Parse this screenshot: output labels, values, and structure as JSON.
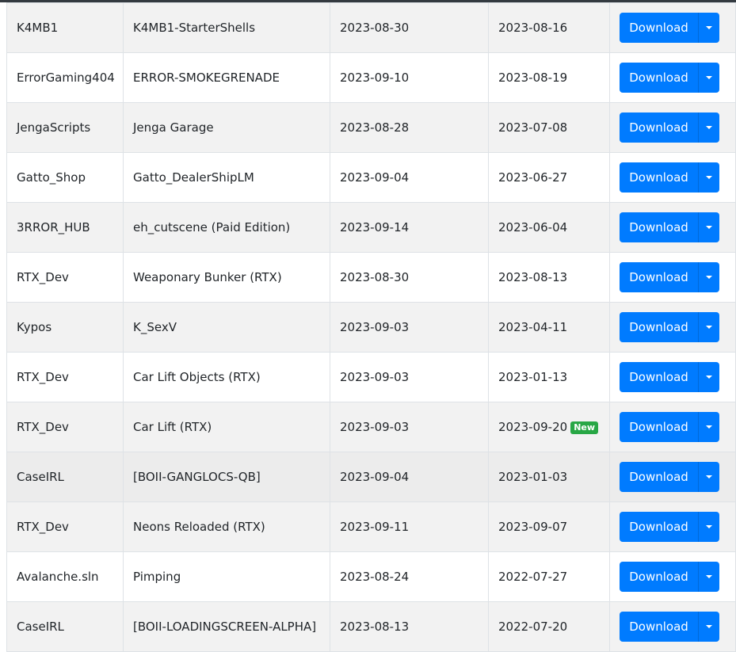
{
  "table": {
    "rows": [
      {
        "author": "K4MB1",
        "name": "K4MB1-StarterShells",
        "updated": "2023-08-30",
        "created": "2023-08-16",
        "badge": "",
        "action": "Download"
      },
      {
        "author": "ErrorGaming404",
        "name": "ERROR-SMOKEGRENADE",
        "updated": "2023-09-10",
        "created": "2023-08-19",
        "badge": "",
        "action": "Download"
      },
      {
        "author": "JengaScripts",
        "name": "Jenga Garage",
        "updated": "2023-08-28",
        "created": "2023-07-08",
        "badge": "",
        "action": "Download"
      },
      {
        "author": "Gatto_Shop",
        "name": "Gatto_DealerShipLM",
        "updated": "2023-09-04",
        "created": "2023-06-27",
        "badge": "",
        "action": "Download"
      },
      {
        "author": "3RROR_HUB",
        "name": "eh_cutscene (Paid Edition)",
        "updated": "2023-09-14",
        "created": "2023-06-04",
        "badge": "",
        "action": "Download"
      },
      {
        "author": "RTX_Dev",
        "name": "Weaponary Bunker (RTX)",
        "updated": "2023-08-30",
        "created": "2023-08-13",
        "badge": "",
        "action": "Download"
      },
      {
        "author": "Kypos",
        "name": "K_SexV",
        "updated": "2023-09-03",
        "created": "2023-04-11",
        "badge": "",
        "action": "Download"
      },
      {
        "author": "RTX_Dev",
        "name": "Car Lift Objects (RTX)",
        "updated": "2023-09-03",
        "created": "2023-01-13",
        "badge": "",
        "action": "Download"
      },
      {
        "author": "RTX_Dev",
        "name": "Car Lift (RTX)",
        "updated": "2023-09-03",
        "created": "2023-09-20",
        "badge": "New",
        "action": "Download"
      },
      {
        "author": "CaseIRL",
        "name": "[BOII-GANGLOCS-QB]",
        "updated": "2023-09-04",
        "created": "2023-01-03",
        "badge": "",
        "action": "Download"
      },
      {
        "author": "RTX_Dev",
        "name": "Neons Reloaded (RTX)",
        "updated": "2023-09-11",
        "created": "2023-09-07",
        "badge": "",
        "action": "Download"
      },
      {
        "author": "Avalanche.sln",
        "name": "Pimping",
        "updated": "2023-08-24",
        "created": "2022-07-27",
        "badge": "",
        "action": "Download"
      },
      {
        "author": "CaseIRL",
        "name": "[BOII-LOADINGSCREEN-ALPHA]",
        "updated": "2023-08-13",
        "created": "2022-07-20",
        "badge": "",
        "action": "Download"
      }
    ]
  },
  "colors": {
    "button": "#007bff",
    "badge_new": "#28a745",
    "row_striped": "#f2f2f2",
    "top_bar": "#343a40"
  },
  "icons": {
    "dropdown": "caret-down-icon"
  }
}
